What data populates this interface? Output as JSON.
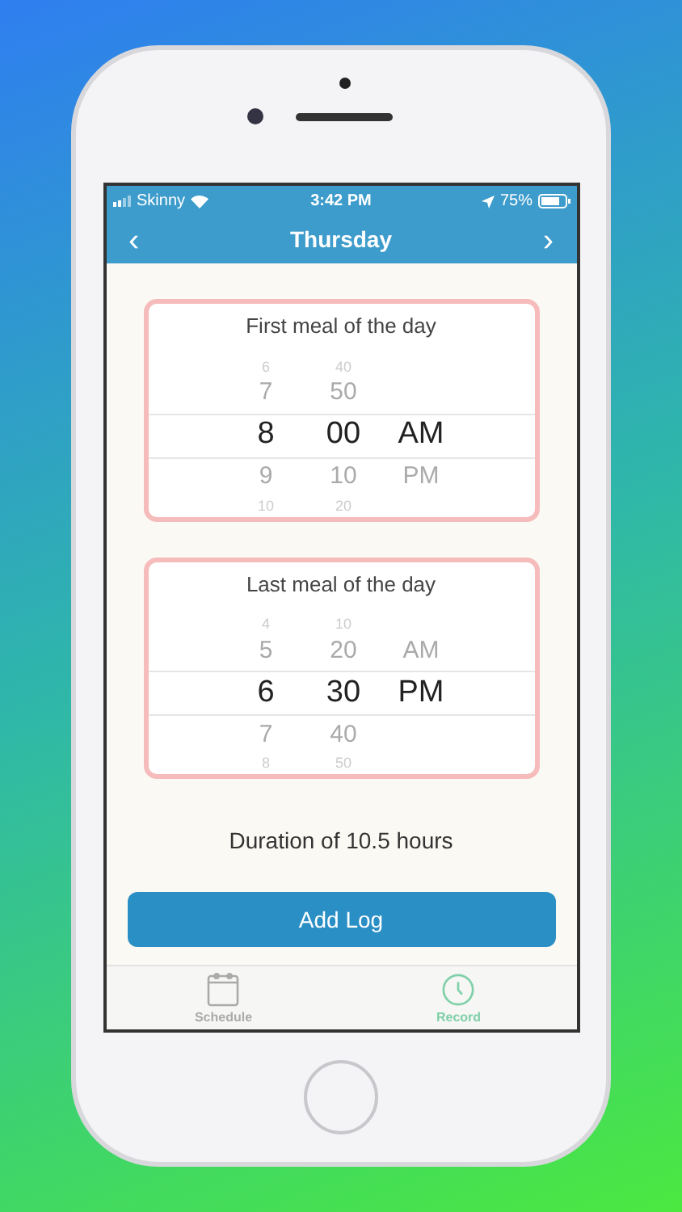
{
  "status_bar": {
    "carrier": "Skinny",
    "time": "3:42 PM",
    "battery": "75%"
  },
  "nav": {
    "back": "‹",
    "title": "Thursday",
    "forward": "›"
  },
  "pickers": [
    {
      "title": "First meal of the day",
      "rows": [
        {
          "kind": "edge",
          "selected": false,
          "hour": "6",
          "minute": "40"
        },
        {
          "kind": "row",
          "selected": false,
          "hour": "7",
          "minute": "50"
        },
        {
          "kind": "row",
          "selected": true,
          "hour": "8",
          "minute": "00",
          "period": "AM"
        },
        {
          "kind": "row",
          "selected": false,
          "hour": "9",
          "minute": "10",
          "period": "PM"
        },
        {
          "kind": "edge",
          "selected": false,
          "hour": "10",
          "minute": "20"
        }
      ]
    },
    {
      "title": "Last meal of the day",
      "rows": [
        {
          "kind": "edge",
          "selected": false,
          "hour": "4",
          "minute": "10"
        },
        {
          "kind": "row",
          "selected": false,
          "hour": "5",
          "minute": "20",
          "period": "AM"
        },
        {
          "kind": "row",
          "selected": true,
          "hour": "6",
          "minute": "30",
          "period": "PM"
        },
        {
          "kind": "row",
          "selected": false,
          "hour": "7",
          "minute": "40"
        },
        {
          "kind": "edge",
          "selected": false,
          "hour": "8",
          "minute": "50"
        }
      ]
    }
  ],
  "duration": "Duration of 10.5 hours",
  "add_button": "Add Log",
  "tabs": [
    {
      "label": "Schedule",
      "kind": "calendar",
      "selected": false
    },
    {
      "label": "Record",
      "kind": "clock",
      "selected": true
    }
  ]
}
